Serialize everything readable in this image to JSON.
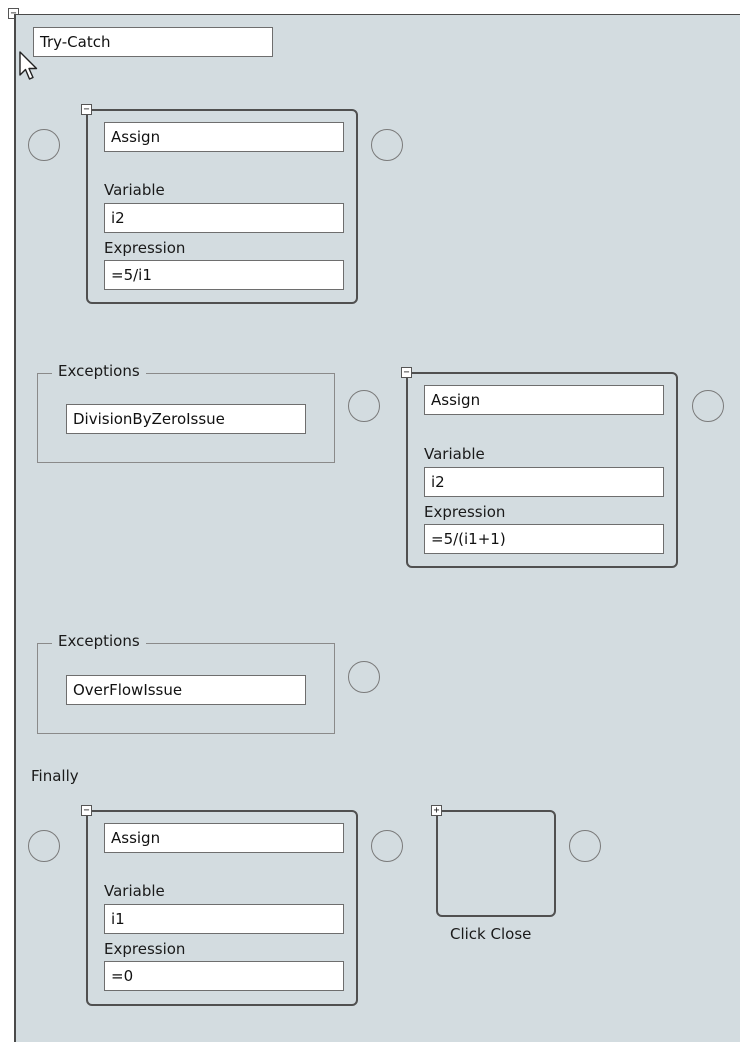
{
  "try_catch": {
    "title": "Try-Catch",
    "collapse_glyph": "−"
  },
  "try_block": {
    "assign": {
      "title": "Assign",
      "variable_label": "Variable",
      "variable_value": "i2",
      "expression_label": "Expression",
      "expression_value": "=5/i1",
      "toggle_glyph": "−"
    }
  },
  "catches": [
    {
      "legend": "Exceptions",
      "exception_type": "DivisionByZeroIssue",
      "assign": {
        "title": "Assign",
        "variable_label": "Variable",
        "variable_value": "i2",
        "expression_label": "Expression",
        "expression_value": "=5/(i1+1)",
        "toggle_glyph": "−"
      }
    },
    {
      "legend": "Exceptions",
      "exception_type": "OverFlowIssue"
    }
  ],
  "finally": {
    "label": "Finally",
    "assign": {
      "title": "Assign",
      "variable_label": "Variable",
      "variable_value": "i1",
      "expression_label": "Expression",
      "expression_value": "=0",
      "toggle_glyph": "−"
    },
    "collapsed_activity": {
      "caption": "Click Close",
      "toggle_glyph": "+"
    }
  }
}
